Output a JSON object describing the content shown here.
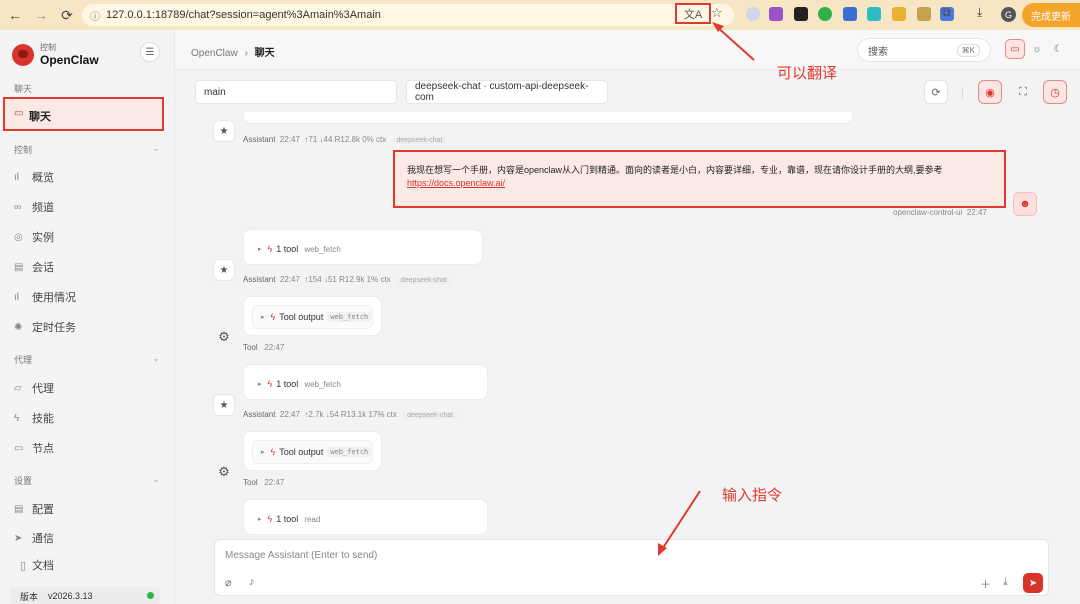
{
  "browser": {
    "url": "127.0.0.1:18789/chat?session=agent%3Amain%3Amain",
    "update_button": "完成更新",
    "profile_initial": "G"
  },
  "sidebar": {
    "logo_sub": "控制",
    "logo_main": "OpenClaw",
    "sections": [
      {
        "label": "聊天",
        "items": [
          "聊天"
        ]
      },
      {
        "label": "控制",
        "items": [
          "概览",
          "频道",
          "实例",
          "会话",
          "使用情况",
          "定时任务"
        ]
      },
      {
        "label": "代理",
        "items": [
          "代理",
          "技能",
          "节点"
        ]
      },
      {
        "label": "设置",
        "items": [
          "配置",
          "通信"
        ]
      }
    ],
    "docs": "文档",
    "version_label": "版本",
    "version_value": "v2026.3.13"
  },
  "topbar": {
    "crumb_root": "OpenClaw",
    "crumb_current": "聊天",
    "search_placeholder": "搜索",
    "search_kbd": "⌘K"
  },
  "selectors": {
    "session": "main",
    "model": "deepseek-chat · custom-api-deepseek-com"
  },
  "messages": {
    "m0_meta": {
      "role": "Assistant",
      "time": "22:47",
      "stats": "↑71  ↓44  R12.8k  0% ctx",
      "model": "deepseek-chat"
    },
    "user": {
      "text": "我现在想写一个手册，内容是openclaw从入门到精通。面向的读者是小白，内容要详细，专业，靠谱，现在请你设计手册的大纲,要参考",
      "link": "https://docs.openclaw.ai/",
      "sender": "openclaw-control-ui",
      "time": "22:47"
    },
    "m1": {
      "tool_label": "1 tool",
      "tool_name": "web_fetch"
    },
    "m1_meta": {
      "role": "Assistant",
      "time": "22:47",
      "stats": "↑154  ↓51  R12.9k  1% ctx",
      "model": "deepseek-chat"
    },
    "t1": {
      "label": "Tool output",
      "tool_name": "web_fetch",
      "role": "Tool",
      "time": "22:47"
    },
    "m2": {
      "tool_label": "1 tool",
      "tool_name": "web_fetch"
    },
    "m2_meta": {
      "role": "Assistant",
      "time": "22:47",
      "stats": "↑2.7k  ↓54  R13.1k  17% ctx",
      "model": "deepseek-chat"
    },
    "t2": {
      "label": "Tool output",
      "tool_name": "web_fetch",
      "role": "Tool",
      "time": "22:47"
    },
    "m3": {
      "tool_label": "1 tool",
      "tool_name": "read"
    }
  },
  "composer": {
    "placeholder": "Message Assistant (Enter to send)"
  },
  "annotations": {
    "translate": "可以翻译",
    "input": "输入指令"
  },
  "colors": {
    "accent": "#d9342b",
    "annotation": "#e0392f",
    "chrome": "#f7e6c4",
    "status_ok": "#2db34a"
  }
}
